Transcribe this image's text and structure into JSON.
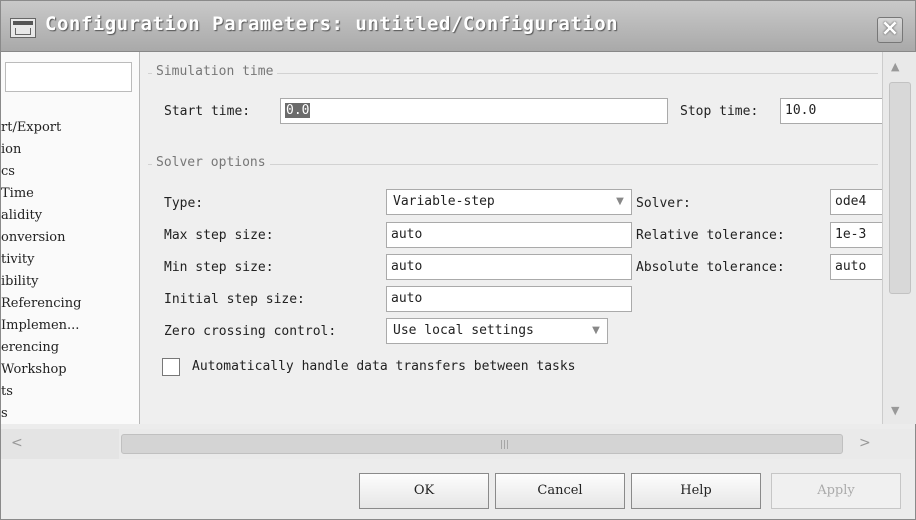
{
  "window": {
    "title": "Configuration Parameters: untitled/Configuration",
    "close_glyph": "×"
  },
  "tree": {
    "items": [
      "rt/Export",
      "ion",
      "cs",
      " Time",
      "alidity",
      "onversion",
      "tivity",
      "ibility",
      "Referencing",
      "Implemen...",
      "erencing",
      " Workshop",
      "ts",
      "s"
    ]
  },
  "simulation_time": {
    "group_title": "Simulation time",
    "start_label": "Start time:",
    "start_value": "0.0",
    "stop_label": "Stop time:",
    "stop_value": "10.0"
  },
  "solver_options": {
    "group_title": "Solver options",
    "type_label": "Type:",
    "type_value": "Variable-step",
    "solver_label": "Solver:",
    "solver_value": "ode4",
    "max_step_label": "Max step size:",
    "max_step_value": "auto",
    "rel_tol_label": "Relative tolerance:",
    "rel_tol_value": "1e-3",
    "min_step_label": "Min step size:",
    "min_step_value": "auto",
    "abs_tol_label": "Absolute tolerance:",
    "abs_tol_value": "auto",
    "init_step_label": "Initial step size:",
    "init_step_value": "auto",
    "zero_cross_label": "Zero crossing control:",
    "zero_cross_value": "Use local settings",
    "auto_transfer_label": "Automatically handle data transfers between tasks",
    "auto_transfer_checked": false
  },
  "scrollbars": {
    "up_arrow": "▲",
    "down_arrow": "▼",
    "left_arrow": "<",
    "right_arrow": ">",
    "grip": "|||"
  },
  "buttons": {
    "ok": "OK",
    "cancel": "Cancel",
    "help": "Help",
    "apply": "Apply"
  }
}
